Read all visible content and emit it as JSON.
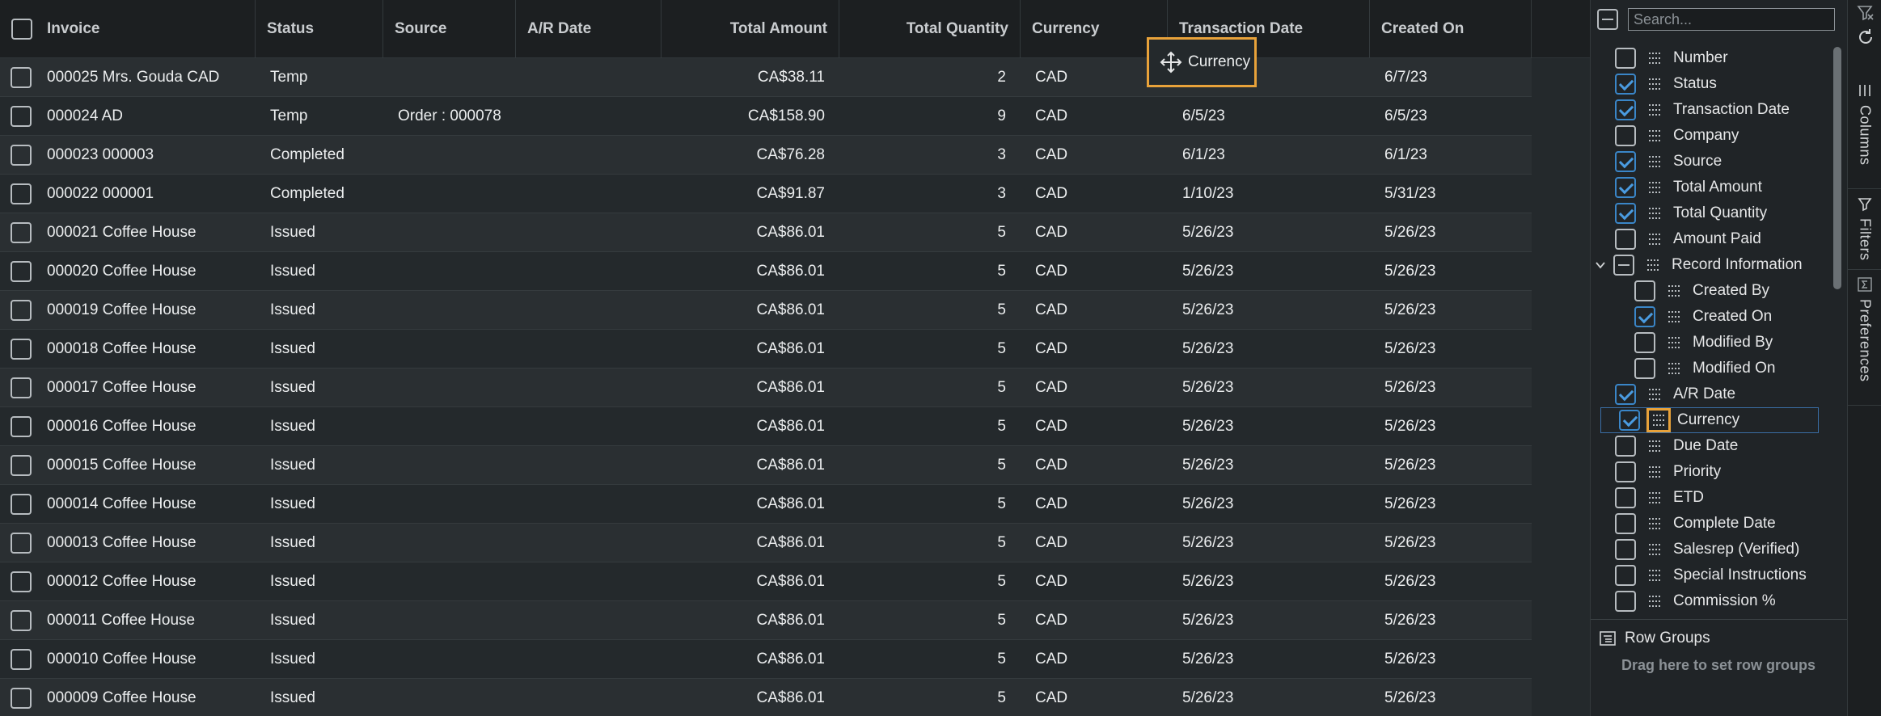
{
  "grid": {
    "columns": [
      {
        "key": "invoice",
        "label": "Invoice"
      },
      {
        "key": "status",
        "label": "Status"
      },
      {
        "key": "source",
        "label": "Source"
      },
      {
        "key": "ar_date",
        "label": "A/R Date"
      },
      {
        "key": "total_amount",
        "label": "Total Amount"
      },
      {
        "key": "total_quantity",
        "label": "Total Quantity"
      },
      {
        "key": "currency",
        "label": "Currency"
      },
      {
        "key": "transaction_date",
        "label": "Transaction Date"
      },
      {
        "key": "created_on",
        "label": "Created On"
      }
    ],
    "rows": [
      {
        "invoice": "000025 Mrs. Gouda CAD",
        "status": "Temp",
        "source": "",
        "ar_date": "",
        "total_amount": "CA$38.11",
        "total_quantity": "2",
        "currency": "CAD",
        "transaction_date": "",
        "created_on": "6/7/23"
      },
      {
        "invoice": "000024 AD",
        "status": "Temp",
        "source": "Order : 000078",
        "ar_date": "",
        "total_amount": "CA$158.90",
        "total_quantity": "9",
        "currency": "CAD",
        "transaction_date": "6/5/23",
        "created_on": "6/5/23"
      },
      {
        "invoice": "000023 000003",
        "status": "Completed",
        "source": "",
        "ar_date": "",
        "total_amount": "CA$76.28",
        "total_quantity": "3",
        "currency": "CAD",
        "transaction_date": "6/1/23",
        "created_on": "6/1/23"
      },
      {
        "invoice": "000022 000001",
        "status": "Completed",
        "source": "",
        "ar_date": "",
        "total_amount": "CA$91.87",
        "total_quantity": "3",
        "currency": "CAD",
        "transaction_date": "1/10/23",
        "created_on": "5/31/23"
      },
      {
        "invoice": "000021 Coffee House",
        "status": "Issued",
        "source": "",
        "ar_date": "",
        "total_amount": "CA$86.01",
        "total_quantity": "5",
        "currency": "CAD",
        "transaction_date": "5/26/23",
        "created_on": "5/26/23"
      },
      {
        "invoice": "000020 Coffee House",
        "status": "Issued",
        "source": "",
        "ar_date": "",
        "total_amount": "CA$86.01",
        "total_quantity": "5",
        "currency": "CAD",
        "transaction_date": "5/26/23",
        "created_on": "5/26/23"
      },
      {
        "invoice": "000019 Coffee House",
        "status": "Issued",
        "source": "",
        "ar_date": "",
        "total_amount": "CA$86.01",
        "total_quantity": "5",
        "currency": "CAD",
        "transaction_date": "5/26/23",
        "created_on": "5/26/23"
      },
      {
        "invoice": "000018 Coffee House",
        "status": "Issued",
        "source": "",
        "ar_date": "",
        "total_amount": "CA$86.01",
        "total_quantity": "5",
        "currency": "CAD",
        "transaction_date": "5/26/23",
        "created_on": "5/26/23"
      },
      {
        "invoice": "000017 Coffee House",
        "status": "Issued",
        "source": "",
        "ar_date": "",
        "total_amount": "CA$86.01",
        "total_quantity": "5",
        "currency": "CAD",
        "transaction_date": "5/26/23",
        "created_on": "5/26/23"
      },
      {
        "invoice": "000016 Coffee House",
        "status": "Issued",
        "source": "",
        "ar_date": "",
        "total_amount": "CA$86.01",
        "total_quantity": "5",
        "currency": "CAD",
        "transaction_date": "5/26/23",
        "created_on": "5/26/23"
      },
      {
        "invoice": "000015 Coffee House",
        "status": "Issued",
        "source": "",
        "ar_date": "",
        "total_amount": "CA$86.01",
        "total_quantity": "5",
        "currency": "CAD",
        "transaction_date": "5/26/23",
        "created_on": "5/26/23"
      },
      {
        "invoice": "000014 Coffee House",
        "status": "Issued",
        "source": "",
        "ar_date": "",
        "total_amount": "CA$86.01",
        "total_quantity": "5",
        "currency": "CAD",
        "transaction_date": "5/26/23",
        "created_on": "5/26/23"
      },
      {
        "invoice": "000013 Coffee House",
        "status": "Issued",
        "source": "",
        "ar_date": "",
        "total_amount": "CA$86.01",
        "total_quantity": "5",
        "currency": "CAD",
        "transaction_date": "5/26/23",
        "created_on": "5/26/23"
      },
      {
        "invoice": "000012 Coffee House",
        "status": "Issued",
        "source": "",
        "ar_date": "",
        "total_amount": "CA$86.01",
        "total_quantity": "5",
        "currency": "CAD",
        "transaction_date": "5/26/23",
        "created_on": "5/26/23"
      },
      {
        "invoice": "000011 Coffee House",
        "status": "Issued",
        "source": "",
        "ar_date": "",
        "total_amount": "CA$86.01",
        "total_quantity": "5",
        "currency": "CAD",
        "transaction_date": "5/26/23",
        "created_on": "5/26/23"
      },
      {
        "invoice": "000010 Coffee House",
        "status": "Issued",
        "source": "",
        "ar_date": "",
        "total_amount": "CA$86.01",
        "total_quantity": "5",
        "currency": "CAD",
        "transaction_date": "5/26/23",
        "created_on": "5/26/23"
      },
      {
        "invoice": "000009 Coffee House",
        "status": "Issued",
        "source": "",
        "ar_date": "",
        "total_amount": "CA$86.01",
        "total_quantity": "5",
        "currency": "CAD",
        "transaction_date": "5/26/23",
        "created_on": "5/26/23"
      }
    ]
  },
  "drag_ghost": {
    "label": "Currency",
    "icon": "move-icon"
  },
  "panel": {
    "search_placeholder": "Search...",
    "columns": [
      {
        "label": "Number",
        "checked": false,
        "level": 0
      },
      {
        "label": "Status",
        "checked": true,
        "level": 0
      },
      {
        "label": "Transaction Date",
        "checked": true,
        "level": 0
      },
      {
        "label": "Company",
        "checked": false,
        "level": 0
      },
      {
        "label": "Source",
        "checked": true,
        "level": 0
      },
      {
        "label": "Total Amount",
        "checked": true,
        "level": 0
      },
      {
        "label": "Total Quantity",
        "checked": true,
        "level": 0
      },
      {
        "label": "Amount Paid",
        "checked": false,
        "level": 0
      },
      {
        "label": "Record Information",
        "checked": "partial",
        "level": 0,
        "group": true
      },
      {
        "label": "Created By",
        "checked": false,
        "level": 1
      },
      {
        "label": "Created On",
        "checked": true,
        "level": 1
      },
      {
        "label": "Modified By",
        "checked": false,
        "level": 1
      },
      {
        "label": "Modified On",
        "checked": false,
        "level": 1
      },
      {
        "label": "A/R Date",
        "checked": true,
        "level": 0
      },
      {
        "label": "Currency",
        "checked": true,
        "level": 0,
        "selected": true
      },
      {
        "label": "Due Date",
        "checked": false,
        "level": 0
      },
      {
        "label": "Priority",
        "checked": false,
        "level": 0
      },
      {
        "label": "ETD",
        "checked": false,
        "level": 0
      },
      {
        "label": "Complete Date",
        "checked": false,
        "level": 0
      },
      {
        "label": "Salesrep (Verified)",
        "checked": false,
        "level": 0
      },
      {
        "label": "Special Instructions",
        "checked": false,
        "level": 0
      },
      {
        "label": "Commission %",
        "checked": false,
        "level": 0
      }
    ],
    "row_groups_title": "Row Groups",
    "row_groups_hint": "Drag here to set row groups"
  },
  "tabs": {
    "columns": "Columns",
    "filters": "Filters",
    "preferences": "Preferences"
  },
  "colors": {
    "accent": "#3a86c8",
    "drag_highlight": "#e8a23a",
    "background": "#24292c"
  }
}
